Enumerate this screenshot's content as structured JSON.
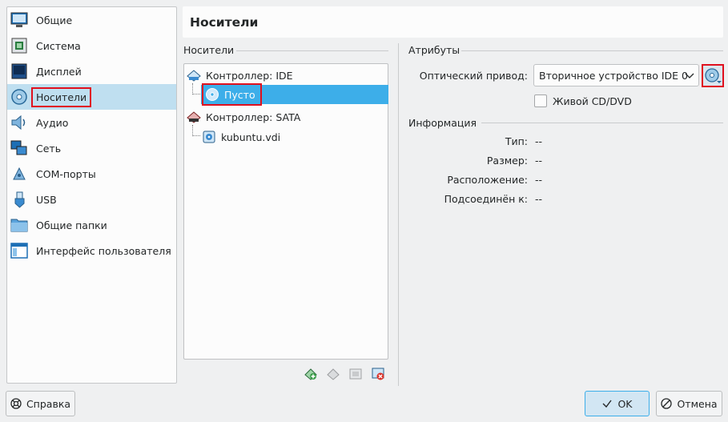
{
  "page_title": "Носители",
  "sidebar": {
    "items": [
      {
        "label": "Общие",
        "icon": "monitor-general-icon"
      },
      {
        "label": "Система",
        "icon": "chip-system-icon"
      },
      {
        "label": "Дисплей",
        "icon": "display-icon"
      },
      {
        "label": "Носители",
        "icon": "storage-disc-icon",
        "selected": true
      },
      {
        "label": "Аудио",
        "icon": "speaker-icon"
      },
      {
        "label": "Сеть",
        "icon": "network-icon"
      },
      {
        "label": "COM-порты",
        "icon": "serial-port-icon"
      },
      {
        "label": "USB",
        "icon": "usb-icon"
      },
      {
        "label": "Общие папки",
        "icon": "shared-folder-icon"
      },
      {
        "label": "Интерфейс пользователя",
        "icon": "user-interface-icon"
      }
    ]
  },
  "storage": {
    "group_title": "Носители",
    "tree": {
      "ide_controller": "Контроллер: IDE",
      "ide_empty": "Пусто",
      "sata_controller": "Контроллер: SATA",
      "sata_disk": "kubuntu.vdi"
    }
  },
  "attributes": {
    "group_title": "Атрибуты",
    "optical_drive_label": "Оптический привод:",
    "optical_drive_value": "Вторичное устройство IDE 0",
    "live_cd_label": "Живой CD/DVD"
  },
  "information": {
    "group_title": "Информация",
    "rows": [
      {
        "label": "Тип:",
        "value": "--"
      },
      {
        "label": "Размер:",
        "value": "--"
      },
      {
        "label": "Расположение:",
        "value": "--"
      },
      {
        "label": "Подсоединён к:",
        "value": "--"
      }
    ]
  },
  "buttons": {
    "help": "Справка",
    "ok": "OK",
    "cancel": "Отмена"
  },
  "colors": {
    "selection": "#3daee9",
    "sidebar_selection": "#bfdff0",
    "highlight_box": "#e0101e"
  }
}
